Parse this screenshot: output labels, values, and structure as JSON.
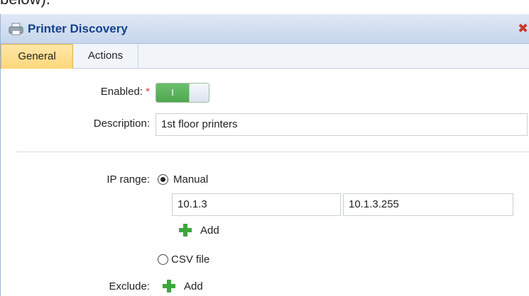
{
  "above_text": "below).",
  "window": {
    "title": "Printer Discovery",
    "close_icon": "close-icon",
    "title_icon": "printer-icon"
  },
  "tabs": [
    {
      "label": "General",
      "active": true
    },
    {
      "label": "Actions",
      "active": false
    }
  ],
  "form": {
    "enabled": {
      "label": "Enabled:",
      "required_mark": "*",
      "toggle_on_text": "I",
      "value": true
    },
    "description": {
      "label": "Description:",
      "value": "1st floor printers"
    },
    "ip_range": {
      "label": "IP range:",
      "options": [
        {
          "label": "Manual",
          "selected": true
        },
        {
          "label": "CSV file",
          "selected": false
        }
      ],
      "from": "10.1.3",
      "to": "10.1.3.255",
      "add_label": "Add"
    },
    "exclude": {
      "label": "Exclude:",
      "add_label": "Add"
    }
  },
  "colors": {
    "accent_tab": "#fdd77a",
    "toggle_on": "#4ea84e",
    "title_text": "#15428b",
    "add_icon": "#3ea63e",
    "close_icon": "#c83a2a"
  }
}
